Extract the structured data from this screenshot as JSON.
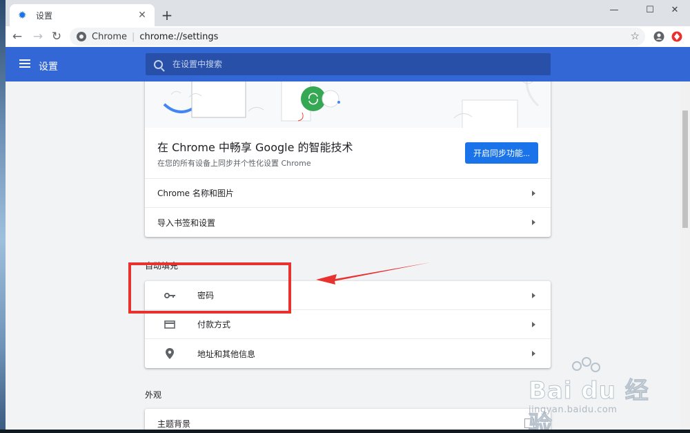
{
  "colors": {
    "header_blue": "#3367d6",
    "accent": "#1a73e8",
    "annotation_red": "#e8322f"
  },
  "browser": {
    "tab_title": "设置",
    "omnibox_chip": "Chrome",
    "omnibox_url": "chrome://settings"
  },
  "settings": {
    "header_title": "设置",
    "search_placeholder": "在设置中搜索"
  },
  "people": {
    "sync_title": "在 Chrome 中畅享 Google 的智能技术",
    "sync_subtitle": "在您的所有设备上同步并个性化设置 Chrome",
    "sync_button": "开启同步功能...",
    "rows": [
      {
        "label": "Chrome 名称和图片"
      },
      {
        "label": "导入书签和设置"
      }
    ]
  },
  "autofill": {
    "section_title": "自动填充",
    "rows": [
      {
        "label": "密码",
        "icon": "key-icon"
      },
      {
        "label": "付款方式",
        "icon": "credit-card-icon"
      },
      {
        "label": "地址和其他信息",
        "icon": "location-pin-icon"
      }
    ]
  },
  "appearance": {
    "section_title": "外观",
    "rows": [
      {
        "label": "主题背景",
        "icon": "open-external-icon"
      }
    ]
  },
  "watermark": {
    "main": "Bai du 经验",
    "sub": "jingyan.baidu.com"
  }
}
